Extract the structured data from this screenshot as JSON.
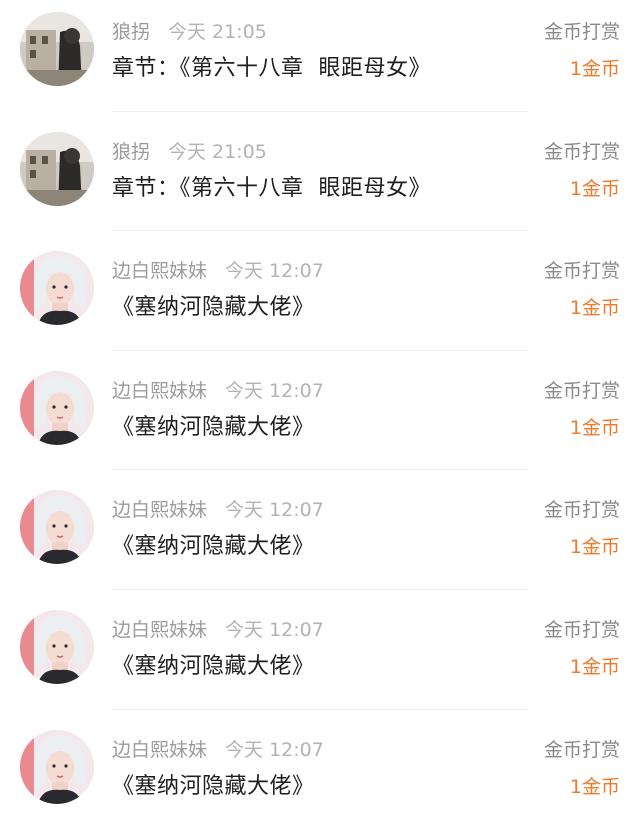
{
  "rewards": [
    {
      "avatar_icon": "building-photo-avatar-icon",
      "user_name": "狼拐",
      "time": "今天 21:05",
      "content": "章节：《第六十八章  眼距母女》",
      "reward_type": "金币打赏",
      "amount": "1金币"
    },
    {
      "avatar_icon": "building-photo-avatar-icon",
      "user_name": "狼拐",
      "time": "今天 21:05",
      "content": "章节：《第六十八章  眼距母女》",
      "reward_type": "金币打赏",
      "amount": "1金币"
    },
    {
      "avatar_icon": "girl-portrait-avatar-icon",
      "user_name": "边白熙妹妹",
      "time": "今天 12:07",
      "content": "《塞纳河隐藏大佬》",
      "reward_type": "金币打赏",
      "amount": "1金币"
    },
    {
      "avatar_icon": "girl-portrait-avatar-icon",
      "user_name": "边白熙妹妹",
      "time": "今天 12:07",
      "content": "《塞纳河隐藏大佬》",
      "reward_type": "金币打赏",
      "amount": "1金币"
    },
    {
      "avatar_icon": "girl-portrait-avatar-icon",
      "user_name": "边白熙妹妹",
      "time": "今天 12:07",
      "content": "《塞纳河隐藏大佬》",
      "reward_type": "金币打赏",
      "amount": "1金币"
    },
    {
      "avatar_icon": "girl-portrait-avatar-icon",
      "user_name": "边白熙妹妹",
      "time": "今天 12:07",
      "content": "《塞纳河隐藏大佬》",
      "reward_type": "金币打赏",
      "amount": "1金币"
    },
    {
      "avatar_icon": "girl-portrait-avatar-icon",
      "user_name": "边白熙妹妹",
      "time": "今天 12:07",
      "content": "《塞纳河隐藏大佬》",
      "reward_type": "金币打赏",
      "amount": "1金币"
    }
  ],
  "colors": {
    "amount": "#f07a2a",
    "meta_text": "#9c9c9c",
    "content_text": "#1f1f1f"
  }
}
